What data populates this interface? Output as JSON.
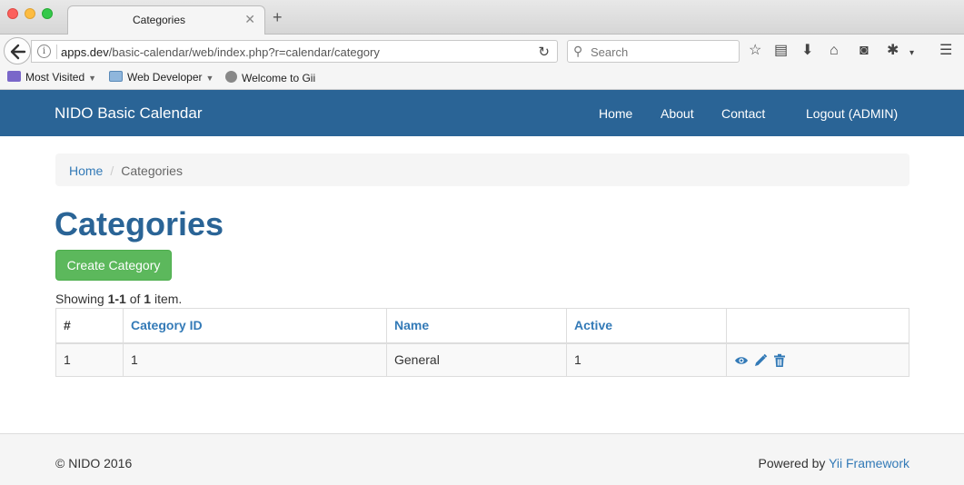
{
  "browser": {
    "tab_title": "Categories",
    "tab_close": "✕",
    "new_tab": "+",
    "url_host": "apps.dev",
    "url_path": "/basic-calendar/web/index.php?r=calendar/category",
    "search_placeholder": "Search",
    "bookmarks": [
      {
        "label": "Most Visited",
        "icon": "most-visited-icon"
      },
      {
        "label": "Web Developer",
        "icon": "folder-icon"
      },
      {
        "label": "Welcome to Gii",
        "icon": "globe-icon"
      }
    ]
  },
  "navbar": {
    "brand": "NIDO Basic Calendar",
    "links": [
      "Home",
      "About",
      "Contact",
      "Logout (ADMIN)"
    ]
  },
  "breadcrumb": {
    "home": "Home",
    "separator": "/",
    "current": "Categories"
  },
  "page": {
    "title": "Categories",
    "create_button": "Create Category",
    "summary": {
      "prefix": "Showing",
      "range": "1-1",
      "of": "of",
      "total": "1",
      "suffix": "item."
    }
  },
  "table": {
    "headers": [
      "#",
      "Category ID",
      "Name",
      "Active",
      ""
    ],
    "rows": [
      {
        "index": "1",
        "category_id": "1",
        "name": "General",
        "active": "1",
        "actions": [
          "view-icon",
          "update-icon",
          "delete-icon"
        ]
      }
    ]
  },
  "footer": {
    "copyright": "© NIDO 2016",
    "powered_prefix": "Powered by",
    "powered_link": "Yii Framework"
  },
  "colors": {
    "navbar_bg": "#2a6496",
    "title": "#2a6496",
    "link": "#337ab7",
    "create_button": "#5cb85c"
  }
}
